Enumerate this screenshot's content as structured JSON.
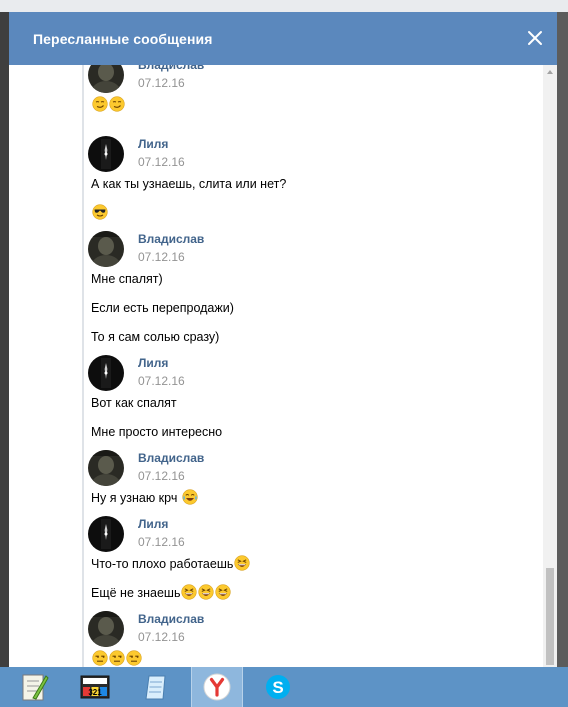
{
  "modal": {
    "title": "Пересланные сообщения"
  },
  "messages": [
    {
      "author": "Владислав",
      "date": "07.12.16",
      "lines": [
        {
          "text": "",
          "emoji": [
            "smirk",
            "smirk"
          ]
        }
      ]
    },
    {
      "author": "Лиля",
      "date": "07.12.16",
      "lines": [
        {
          "text": "А как ты узнаешь, слита или нет?",
          "emoji": []
        },
        {
          "text": "",
          "emoji": [
            "sunglasses"
          ]
        }
      ]
    },
    {
      "author": "Владислав",
      "date": "07.12.16",
      "lines": [
        {
          "text": "Мне спалят)",
          "emoji": []
        },
        {
          "text": "Если есть перепродажи)",
          "emoji": []
        },
        {
          "text": "То я сам солью сразу)",
          "emoji": []
        }
      ]
    },
    {
      "author": "Лиля",
      "date": "07.12.16",
      "lines": [
        {
          "text": "Вот как спалят",
          "emoji": []
        },
        {
          "text": "Мне просто интересно",
          "emoji": []
        }
      ]
    },
    {
      "author": "Владислав",
      "date": "07.12.16",
      "lines": [
        {
          "text": "Ну я узнаю крч ",
          "emoji": [
            "joy"
          ]
        }
      ]
    },
    {
      "author": "Лиля",
      "date": "07.12.16",
      "lines": [
        {
          "text": "Что-то плохо работаешь",
          "emoji": [
            "laughing"
          ]
        },
        {
          "text": "Ещё не знаешь",
          "emoji": [
            "laughing",
            "laughing",
            "laughing"
          ]
        }
      ]
    },
    {
      "author": "Владислав",
      "date": "07.12.16",
      "lines": [
        {
          "text": "",
          "emoji": [
            "unamused",
            "unamused",
            "unamused"
          ]
        }
      ]
    }
  ],
  "taskbar": {
    "items": [
      "notepad-plus-icon",
      "media-player-classic-icon",
      "notepad-icon",
      "yandex-browser-icon",
      "skype-icon"
    ],
    "active": "yandex-browser-icon"
  },
  "colors": {
    "header": "#5b88bd",
    "author": "#42648b",
    "date": "#939393",
    "taskbar": "#5d93c6"
  }
}
